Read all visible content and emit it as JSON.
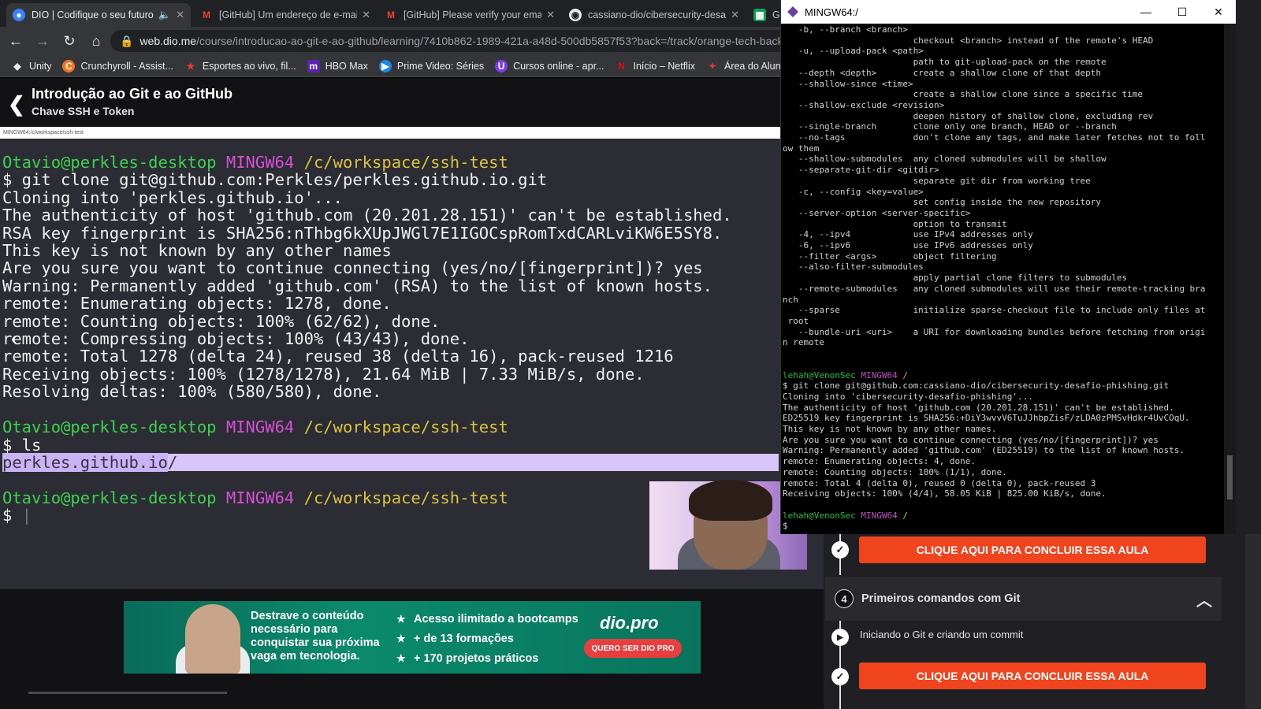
{
  "browser": {
    "tabs": [
      {
        "title": "DIO | Codifique o seu futuro",
        "active": true,
        "audio_icon": "speaker-icon",
        "favicon": "dio-icon"
      },
      {
        "title": "[GitHub] Um endereço de e-mail",
        "favicon": "gmail-icon"
      },
      {
        "title": "[GitHub] Please verify your email",
        "favicon": "gmail-icon"
      },
      {
        "title": "cassiano-dio/cibersecurity-desafi",
        "favicon": "github-icon"
      },
      {
        "title": "G",
        "favicon": "sheets-icon"
      }
    ],
    "address_host": "web.dio.me",
    "address_path": "/course/introducao-ao-git-e-ao-github/learning/7410b862-1989-421a-a48d-500db5857f53?back=/track/orange-tech-backe",
    "bookmarks": [
      "Unity",
      "Crunchyroll - Assist...",
      "Esportes ao vivo, fil...",
      "HBO Max",
      "Prime Video: Séries",
      "Cursos online - apr...",
      "Início – Netflix",
      "Área do Aluno | UP..."
    ]
  },
  "page": {
    "course_title": "Introdução ao Git e ao GitHub",
    "lesson_title": "Chave SSH e Token",
    "video_window_title": "MINGW64:/c/workspace/ssh-test"
  },
  "video_terminal": {
    "user": "Otavio@perkles-desktop",
    "env": "MINGW64",
    "cwd": "/c/workspace/ssh-test",
    "lines": [
      "$ git clone git@github.com:Perkles/perkles.github.io.git",
      "Cloning into 'perkles.github.io'...",
      "The authenticity of host 'github.com (20.201.28.151)' can't be established.",
      "RSA key fingerprint is SHA256:nThbg6kXUpJWGl7E1IGOCspRomTxdCARLviKW6E5SY8.",
      "This key is not known by any other names",
      "Are you sure you want to continue connecting (yes/no/[fingerprint])? yes",
      "Warning: Permanently added 'github.com' (RSA) to the list of known hosts.",
      "remote: Enumerating objects: 1278, done.",
      "remote: Counting objects: 100% (62/62), done.",
      "remote: Compressing objects: 100% (43/43), done.",
      "remote: Total 1278 (delta 24), reused 38 (delta 16), pack-reused 1216",
      "Receiving objects: 100% (1278/1278), 21.64 MiB | 7.33 MiB/s, done.",
      "Resolving deltas: 100% (580/580), done."
    ],
    "ls_cmd": "$ ls",
    "ls_output": "perkles.github.io",
    "ls_suffix": "/",
    "prompt": "$ "
  },
  "banner": {
    "lead": "Destrave o conteúdo necessário para conquistar sua próxima vaga em tecnologia.",
    "bullets": [
      "Acesso ilimitado a bootcamps",
      "+ de 13 formações",
      "+ 170 projetos práticos"
    ],
    "logo": "dio.pro",
    "cta": "QUERO SER DIO PRO"
  },
  "sidebar": {
    "complete_label": "CLIQUE AQUI PARA CONCLUIR ESSA AULA",
    "module_number": "4",
    "module_title": "Primeiros comandos com Git",
    "lesson": "Iniciando o Git e criando um commit",
    "complete_label_2": "CLIQUE AQUI PARA CONCLUIR ESSA AULA"
  },
  "terminal_window": {
    "title": "MINGW64:/",
    "help_lines": [
      "   -b, --branch <branch>",
      "                         checkout <branch> instead of the remote's HEAD",
      "   -u, --upload-pack <path>",
      "                         path to git-upload-pack on the remote",
      "   --depth <depth>       create a shallow clone of that depth",
      "   --shallow-since <time>",
      "                         create a shallow clone since a specific time",
      "   --shallow-exclude <revision>",
      "                         deepen history of shallow clone, excluding rev",
      "   --single-branch       clone only one branch, HEAD or --branch",
      "   --no-tags             don't clone any tags, and make later fetches not to foll",
      "ow them",
      "   --shallow-submodules  any cloned submodules will be shallow",
      "   --separate-git-dir <gitdir>",
      "                         separate git dir from working tree",
      "   -c, --config <key=value>",
      "                         set config inside the new repository",
      "   --server-option <server-specific>",
      "                         option to transmit",
      "   -4, --ipv4            use IPv4 addresses only",
      "   -6, --ipv6            use IPv6 addresses only",
      "   --filter <args>       object filtering",
      "   --also-filter-submodules",
      "                         apply partial clone filters to submodules",
      "   --remote-submodules   any cloned submodules will use their remote-tracking bra",
      "nch",
      "   --sparse              initialize sparse-checkout file to include only files at",
      " root",
      "   --bundle-uri <uri>    a URI for downloading bundles before fetching from origi",
      "n remote"
    ],
    "user": "lehah@VenonSec",
    "env": "MINGW64",
    "cwd": "/",
    "clone_lines": [
      "$ git clone git@github.com:cassiano-dio/cibersecurity-desafio-phishing.git",
      "Cloning into 'cibersecurity-desafio-phishing'...",
      "The authenticity of host 'github.com (20.201.28.151)' can't be established.",
      "ED25519 key fingerprint is SHA256:+DiY3wvvV6TuJJhbpZisF/zLDA0zPMSvHdkr4UvCOqU.",
      "This key is not known by any other names.",
      "Are you sure you want to continue connecting (yes/no/[fingerprint])? yes",
      "Warning: Permanently added 'github.com' (ED25519) to the list of known hosts.",
      "remote: Enumerating objects: 4, done.",
      "remote: Counting objects: 100% (1/1), done.",
      "remote: Total 4 (delta 0), reused 0 (delta 0), pack-reused 3",
      "Receiving objects: 100% (4/4), 58.05 KiB | 825.00 KiB/s, done."
    ],
    "prompt": "$"
  }
}
